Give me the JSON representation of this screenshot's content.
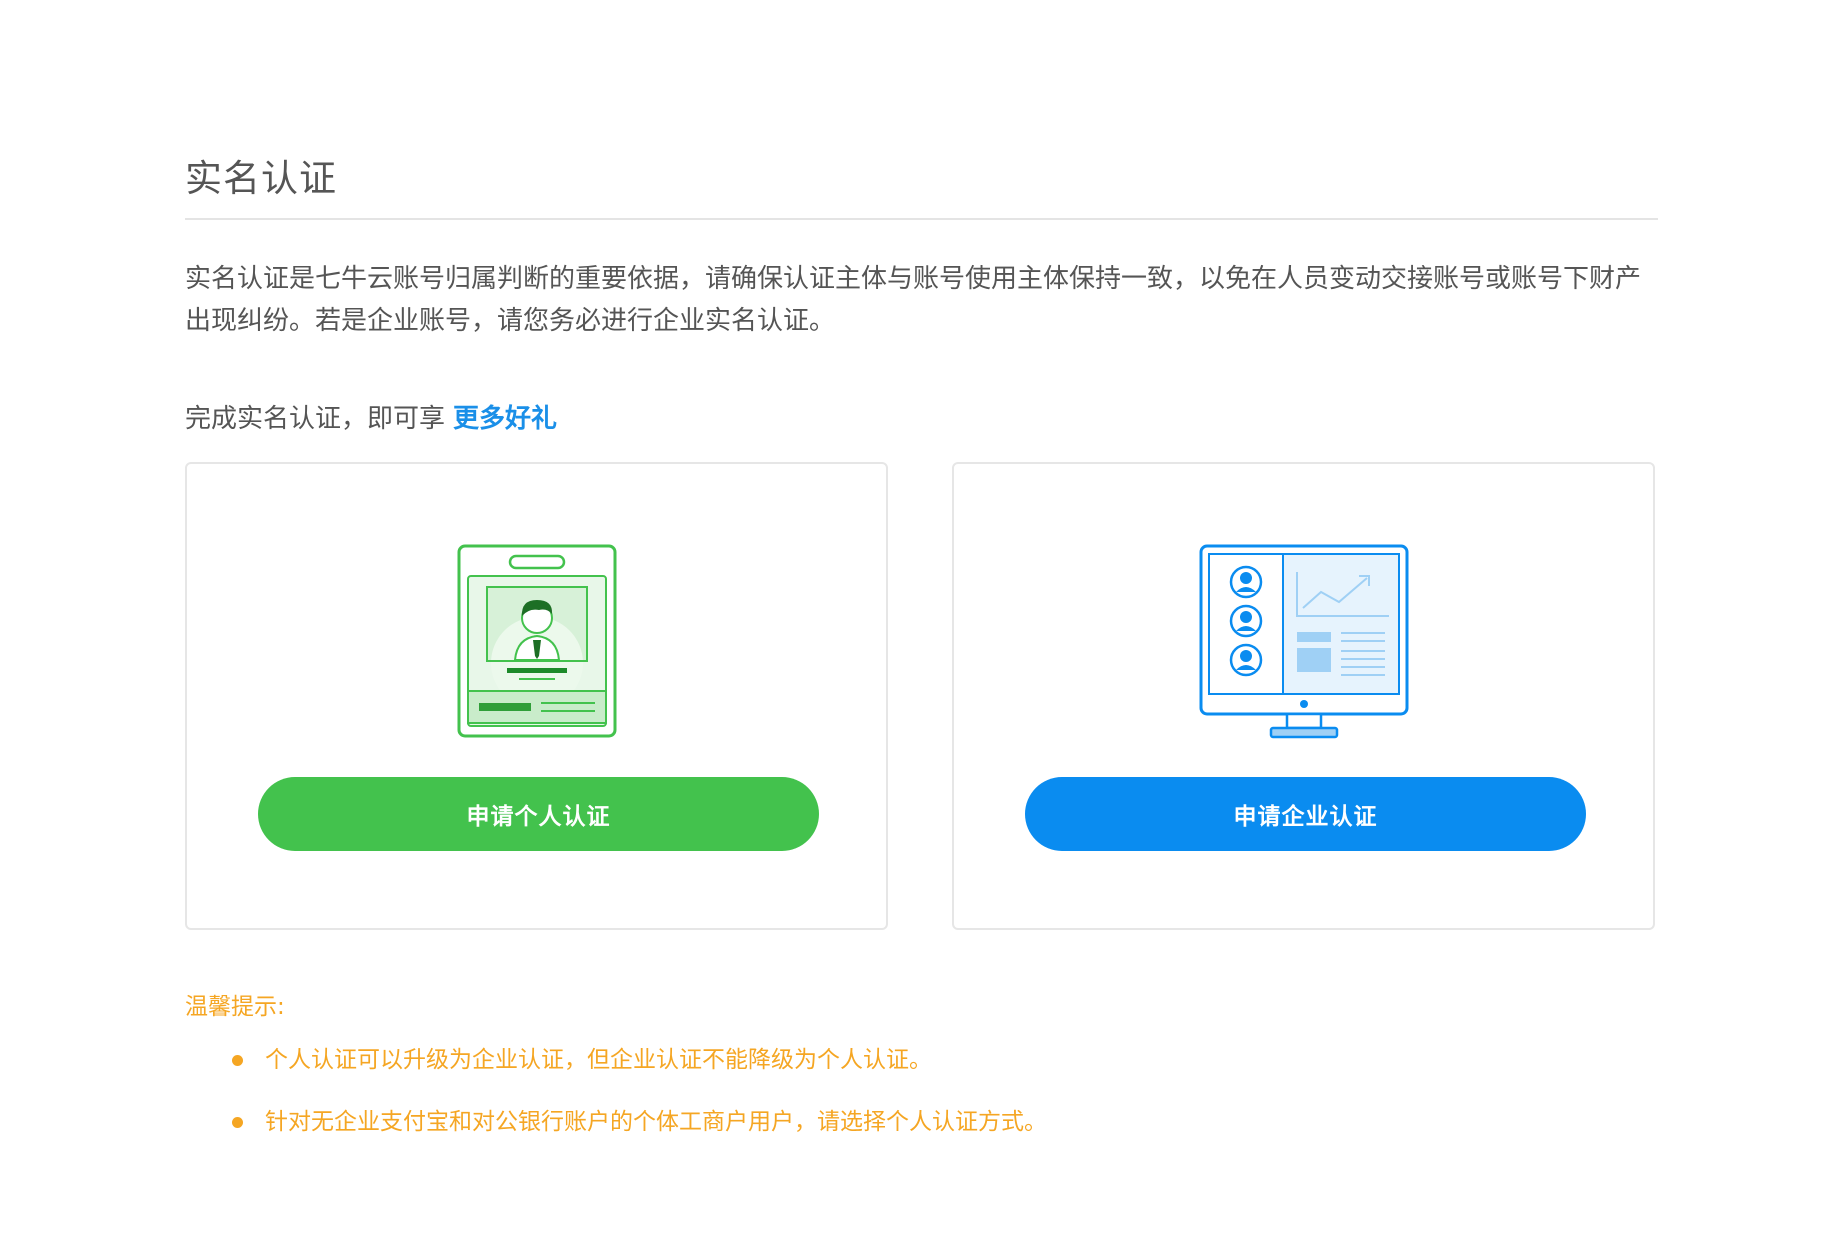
{
  "page": {
    "title": "实名认证",
    "description": "实名认证是七牛云账号归属判断的重要依据，请确保认证主体与账号使用主体保持一致，以免在人员变动交接账号或账号下财产出现纠纷。若是企业账号，请您务必进行企业实名认证。",
    "benefit_text": "完成实名认证，即可享",
    "benefit_link": "更多好礼"
  },
  "cards": {
    "personal": {
      "icon": "personal-id-badge-icon",
      "button_label": "申请个人认证",
      "color": "#43c24d"
    },
    "enterprise": {
      "icon": "enterprise-monitor-icon",
      "button_label": "申请企业认证",
      "color": "#0a8cf0"
    }
  },
  "tips": {
    "title": "温馨提示:",
    "items": [
      "个人认证可以升级为企业认证，但企业认证不能降级为个人认证。",
      "针对无企业支付宝和对公银行账户的个体工商户用户，请选择个人认证方式。"
    ],
    "color": "#f5a623"
  },
  "colors": {
    "link": "#1a8fe8",
    "text": "#555555",
    "border": "#e6e6e6"
  }
}
